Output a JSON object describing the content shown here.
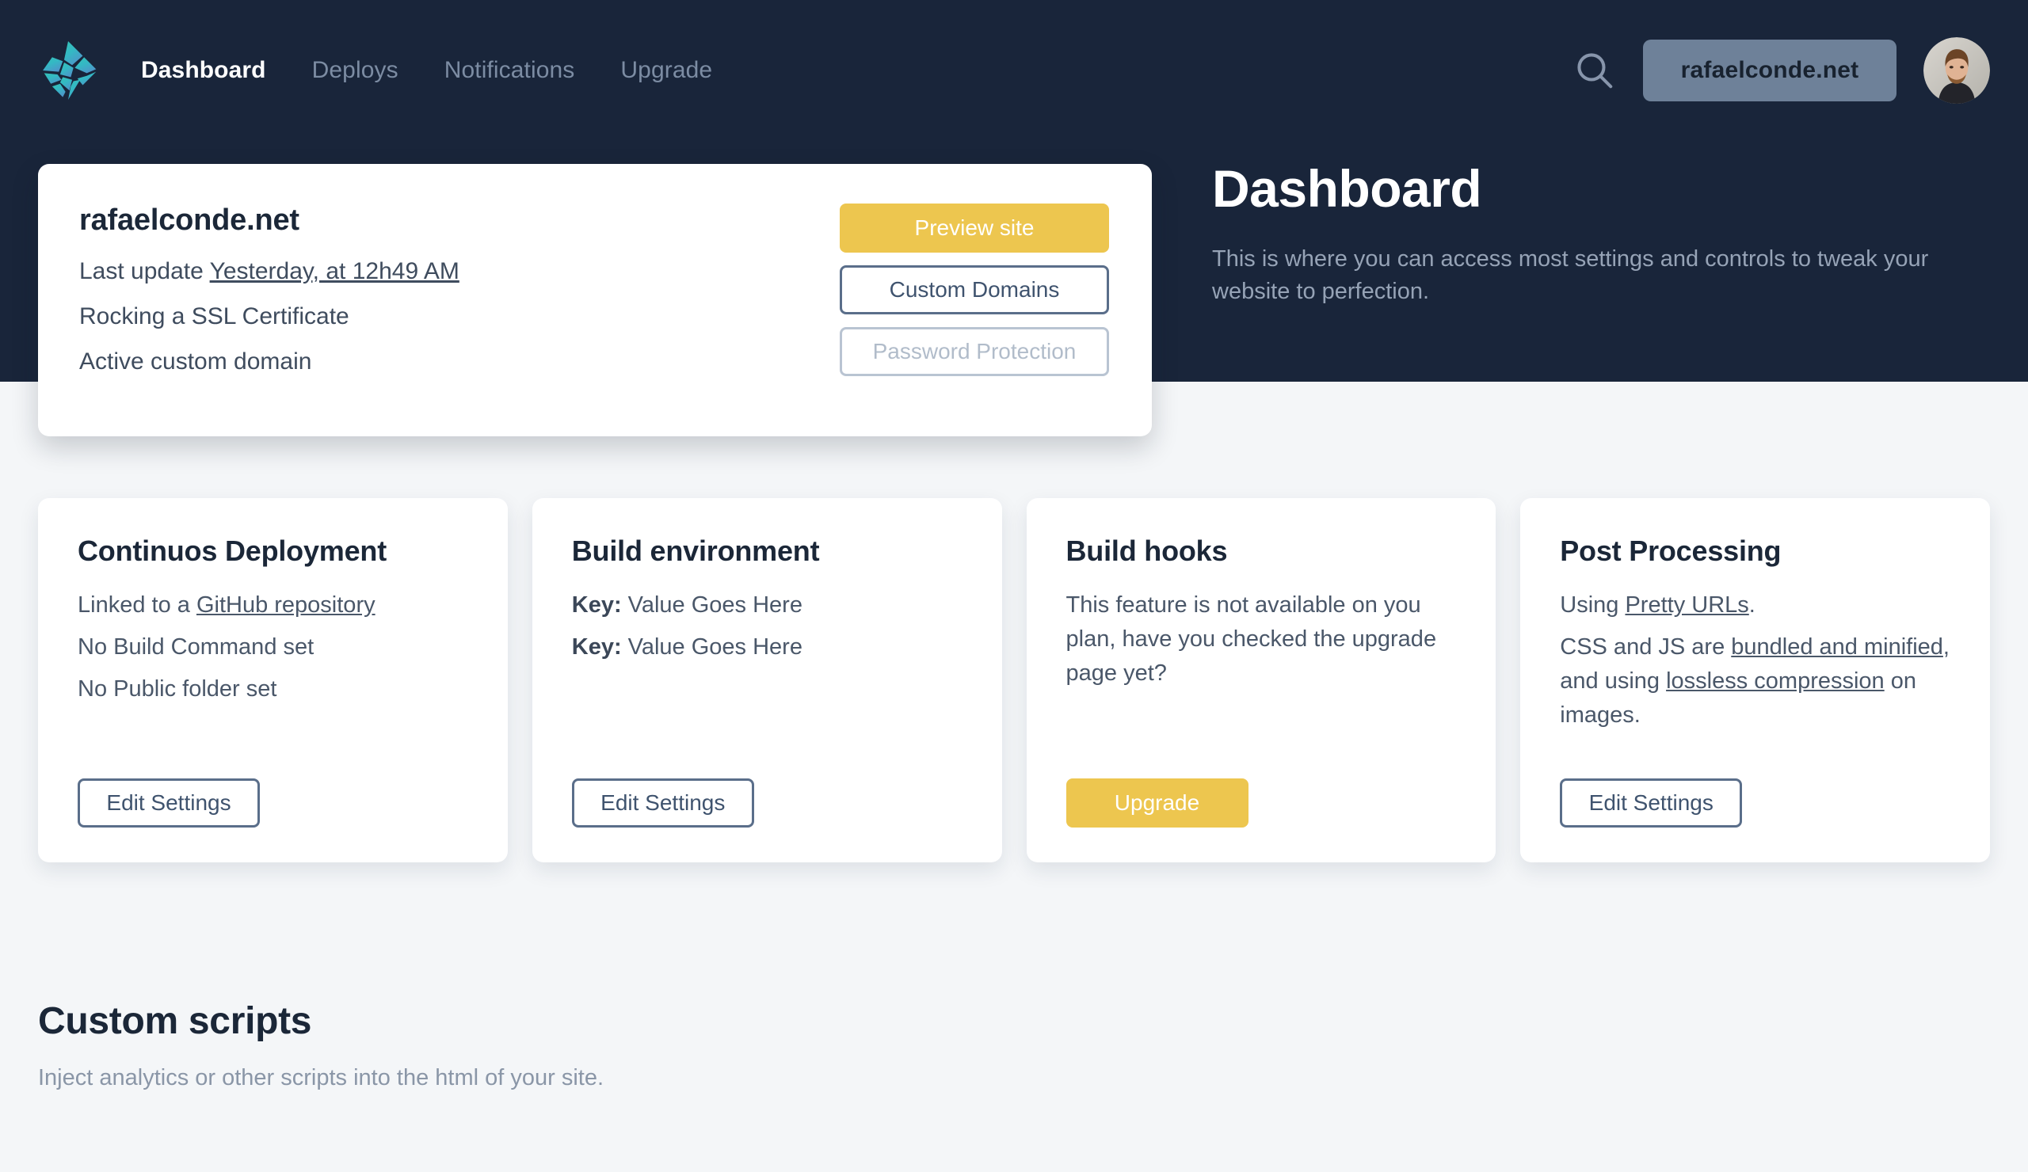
{
  "brand": {
    "logo_icon": "netlify-diamond-logo",
    "colors": {
      "header_bg": "#19253a",
      "page_bg": "#f4f6f8",
      "accent_yellow": "#edc64f",
      "outline_slate": "#5a6e8a",
      "muted_text": "#7c8ca3"
    }
  },
  "nav": {
    "links": [
      {
        "label": "Dashboard",
        "active": true
      },
      {
        "label": "Deploys",
        "active": false
      },
      {
        "label": "Notifications",
        "active": false
      },
      {
        "label": "Upgrade",
        "active": false
      }
    ],
    "search_icon": "search-icon",
    "site_pill_label": "rafaelconde.net",
    "avatar_icon": "user-avatar-photo"
  },
  "page_header": {
    "title": "Dashboard",
    "description": "This is where you can access most settings and controls to tweak your website to perfection."
  },
  "site_card": {
    "title": "rafaelconde.net",
    "last_update_prefix": "Last update ",
    "last_update_link": "Yesterday, at 12h49 AM",
    "ssl_status": "Rocking a SSL Certificate",
    "domain_status": "Active custom domain",
    "actions": {
      "preview": "Preview site",
      "custom_domains": "Custom Domains",
      "password_protection": "Password Protection"
    }
  },
  "cards": [
    {
      "title": "Continuos Deployment",
      "lines": [
        {
          "prefix": "Linked to a ",
          "link": "GitHub repository",
          "suffix": ""
        },
        {
          "prefix": "No Build Command set",
          "link": "",
          "suffix": ""
        },
        {
          "prefix": "No Public folder set",
          "link": "",
          "suffix": ""
        }
      ],
      "button": {
        "label": "Edit Settings",
        "style": "outline"
      }
    },
    {
      "title": "Build environment",
      "env": [
        {
          "key": "Key:",
          "value": " Value Goes Here"
        },
        {
          "key": "Key:",
          "value": " Value Goes Here"
        }
      ],
      "button": {
        "label": "Edit Settings",
        "style": "outline"
      }
    },
    {
      "title": "Build hooks",
      "text": "This feature is not available on you plan, have you checked the upgrade page yet?",
      "button": {
        "label": "Upgrade",
        "style": "primary"
      }
    },
    {
      "title": "Post Processing",
      "line1_prefix": "Using ",
      "line1_link": "Pretty URLs",
      "line1_suffix": ".",
      "line2_prefix": "CSS and JS are ",
      "line2_link_a": "bundled and minified",
      "line2_mid": ", and using ",
      "line2_link_b": "lossless compression",
      "line2_suffix": " on images.",
      "button": {
        "label": "Edit Settings",
        "style": "outline"
      }
    }
  ],
  "custom_scripts": {
    "title": "Custom scripts",
    "description": "Inject analytics or other scripts into the html of your site."
  }
}
